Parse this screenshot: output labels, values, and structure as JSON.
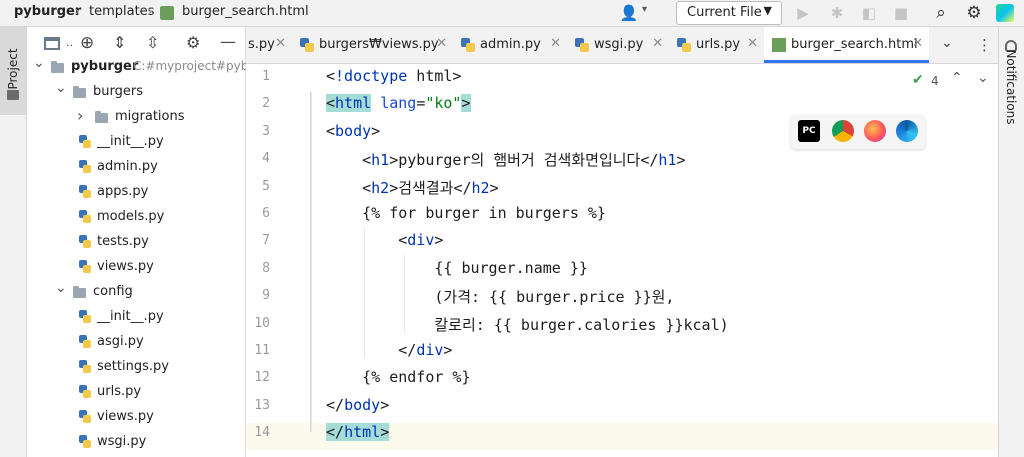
{
  "breadcrumb": {
    "project": "pyburger",
    "folder": "templates",
    "file": "burger_search.html"
  },
  "toolbar": {
    "run_config": "Current File",
    "icons": [
      "user-icon",
      "run-icon",
      "debug-icon",
      "coverage-icon",
      "stop-icon",
      "search-icon",
      "gear-icon",
      "update-icon"
    ]
  },
  "left_stripe": {
    "project_label": "Project"
  },
  "right_stripe": {
    "notifications_label": "Notifications"
  },
  "project_tree": [
    {
      "label": "pyburger",
      "extra": "C:#myproject#pybu",
      "type": "folder",
      "level": 0,
      "expanded": true
    },
    {
      "label": "burgers",
      "type": "folder",
      "level": 1,
      "expanded": true
    },
    {
      "label": "migrations",
      "type": "folder",
      "level": 2,
      "expanded": false
    },
    {
      "label": "__init__.py",
      "type": "py",
      "level": 2
    },
    {
      "label": "admin.py",
      "type": "py",
      "level": 2
    },
    {
      "label": "apps.py",
      "type": "py",
      "level": 2
    },
    {
      "label": "models.py",
      "type": "py",
      "level": 2
    },
    {
      "label": "tests.py",
      "type": "py",
      "level": 2
    },
    {
      "label": "views.py",
      "type": "py",
      "level": 2
    },
    {
      "label": "config",
      "type": "folder",
      "level": 1,
      "expanded": true
    },
    {
      "label": "__init__.py",
      "type": "py",
      "level": 2
    },
    {
      "label": "asgi.py",
      "type": "py",
      "level": 2
    },
    {
      "label": "settings.py",
      "type": "py",
      "level": 2
    },
    {
      "label": "urls.py",
      "type": "py",
      "level": 2
    },
    {
      "label": "views.py",
      "type": "py",
      "level": 2
    },
    {
      "label": "wsgi.py",
      "type": "py",
      "level": 2
    }
  ],
  "tabs": [
    {
      "label": "s.py",
      "active": false
    },
    {
      "label": "burgers₩views.py",
      "active": false
    },
    {
      "label": "admin.py",
      "active": false
    },
    {
      "label": "wsgi.py",
      "active": false
    },
    {
      "label": "urls.py",
      "active": false
    },
    {
      "label": "burger_search.html",
      "active": true
    }
  ],
  "editor": {
    "inspection_count": "4",
    "lines": [
      "<!doctype html>",
      "<html lang=\"ko\">",
      "<body>",
      "    <h1>pyburger의 햄버거 검색화면입니다</h1>",
      "    <h2>검색결과</h2>",
      "    {% for burger in burgers %}",
      "        <div>",
      "            {{ burger.name }}",
      "            (가격: {{ burger.price }}원,",
      "            칼로리: {{ burger.calories }}kcal)",
      "        </div>",
      "    {% endfor %}",
      "</body>",
      "</html>"
    ],
    "line_numbers": [
      "1",
      "2",
      "3",
      "4",
      "5",
      "6",
      "7",
      "8",
      "9",
      "10",
      "11",
      "12",
      "13",
      "14"
    ],
    "current_line": 14
  },
  "browsers": [
    "pycharm-icon",
    "chrome-icon",
    "firefox-icon",
    "edge-icon"
  ],
  "colors": {
    "accent": "#3574f0",
    "tag": "#0033b3",
    "string": "#067d17",
    "match_highlight": "#a5dcd8"
  }
}
